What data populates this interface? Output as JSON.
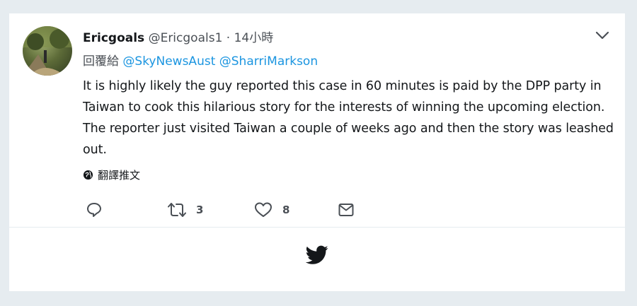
{
  "tweet": {
    "display_name": "Ericgoals",
    "handle": "@Ericgoals1",
    "separator": "·",
    "time": "14小時",
    "reply_prefix": "回覆給",
    "mentions": [
      "@SkyNewsAust",
      "@SharriMarkson"
    ],
    "text": "It is highly likely the guy reported this case in 60 minutes is paid by the DPP party in Taiwan to cook this hilarious story for the interests of winning the upcoming election.  The reporter just visited Taiwan a couple of weeks ago and then the story was leashed out.",
    "translate_label": "翻譯推文"
  },
  "actions": {
    "reply_icon": "reply-icon",
    "retweet_icon": "retweet-icon",
    "retweet_count": "3",
    "like_icon": "heart-icon",
    "like_count": "8",
    "message_icon": "envelope-icon"
  },
  "footer": {
    "logo_icon": "twitter-bird-icon"
  },
  "colors": {
    "link": "#1b95e0",
    "text": "#14171a",
    "muted": "#4a4f55",
    "background": "#e6ecf0"
  }
}
